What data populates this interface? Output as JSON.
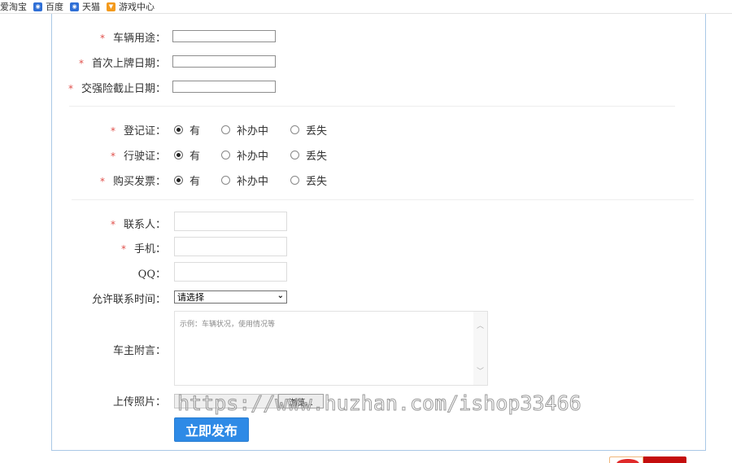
{
  "bookmarks": [
    {
      "label": "爱淘宝",
      "icon": "none"
    },
    {
      "label": "百度",
      "icon": "baidu-icon"
    },
    {
      "label": "天猫",
      "icon": "tmall-icon"
    },
    {
      "label": "游戏中心",
      "icon": "game-center-icon"
    }
  ],
  "vehicle_info": {
    "usage": {
      "label": "车辆用途：",
      "required": "*",
      "value": ""
    },
    "first_plate_date": {
      "label": "首次上牌日期：",
      "required": "*",
      "value": ""
    },
    "insurance_end_date": {
      "label": "交强险截止日期：",
      "required": "*",
      "value": ""
    }
  },
  "documents": {
    "options": [
      "有",
      "补办中",
      "丢失"
    ],
    "rows": [
      {
        "label": "登记证：",
        "required": "*",
        "selected": "有"
      },
      {
        "label": "行驶证：",
        "required": "*",
        "selected": "有"
      },
      {
        "label": "购买发票：",
        "required": "*",
        "selected": "有"
      }
    ]
  },
  "contact": {
    "name": {
      "label": "联系人：",
      "required": "*",
      "value": ""
    },
    "phone": {
      "label": "手机：",
      "required": "*",
      "value": ""
    },
    "qq": {
      "label": "QQ：",
      "value": ""
    },
    "contact_time": {
      "label": "允许联系时间：",
      "selected": "请选择"
    },
    "note": {
      "label": "车主附言：",
      "placeholder": "示例：车辆状况，使用情况等",
      "value": ""
    },
    "photo": {
      "label": "上传照片：",
      "browse_label": "浏览..."
    }
  },
  "submit_label": "立即发布",
  "watermark": "https://www.huzhan.com/ishop33466",
  "colors": {
    "accent": "#2e8ae6",
    "required_star": "#e0504b",
    "panel_border": "#a9c8e6"
  }
}
